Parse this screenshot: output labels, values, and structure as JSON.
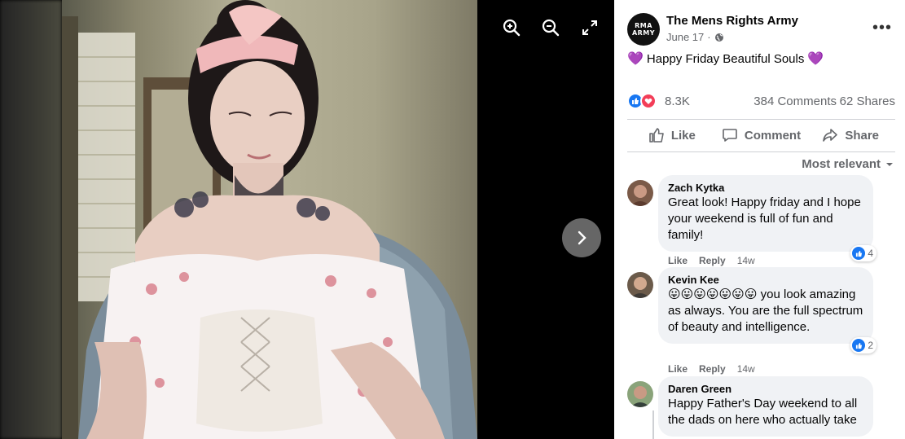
{
  "viewer": {
    "zoom_in_icon": "zoom-in-icon",
    "zoom_out_icon": "zoom-out-icon",
    "fullscreen_icon": "fullscreen-icon",
    "next_icon": "chevron-right-icon"
  },
  "post": {
    "page_avatar_text": "RMA ARMY",
    "page_name": "The Mens Rights Army",
    "date": "June 17",
    "separator": "·",
    "audience_icon": "globe-icon",
    "text_emoji_left": "💜",
    "text": "Happy Friday Beautiful Souls",
    "text_emoji_right": "💜",
    "reaction_count": "8.3K",
    "comment_count": "384 Comments",
    "share_count": "62 Shares"
  },
  "actions": {
    "like": "Like",
    "comment": "Comment",
    "share": "Share"
  },
  "comments_sort": "Most relevant",
  "comments": [
    {
      "name": "Zach Kytka",
      "text": "Great look! Happy friday and I hope your weekend is full of fun and family!",
      "reactions": "4",
      "like": "Like",
      "reply": "Reply",
      "time": "14w"
    },
    {
      "name": "Kevin Kee",
      "text": "😛😛😛😛😛😛😛 you look amazing as always. You are the full spectrum of beauty and intelligence.",
      "reactions": "2",
      "like": "Like",
      "reply": "Reply",
      "time": "14w"
    },
    {
      "name": "Daren Green",
      "text": "Happy Father's Day weekend to all the dads on here who actually take"
    }
  ],
  "colors": {
    "brand_blue": "#1877f2",
    "love_red": "#f33e58",
    "secondary_text": "#65676b",
    "bubble_bg": "#f0f2f5"
  }
}
